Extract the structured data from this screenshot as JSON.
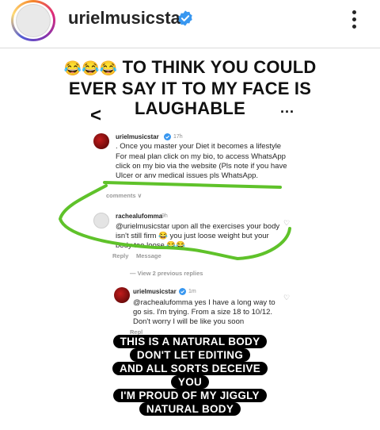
{
  "post": {
    "username": "urielmusicstar",
    "verified": true
  },
  "icons": {
    "avatar": "avatar-icon",
    "verified": "verified-badge-icon",
    "more": "more-options-icon",
    "back": "back-chevron-icon",
    "heart": "heart-icon"
  },
  "repost": {
    "caption_emojis": "😂😂😂",
    "caption_line1": "TO THINK YOU COULD",
    "caption_line2": "EVER SAY IT TO MY FACE IS",
    "caption_line3": "LAUGHABLE",
    "back_glyph": "<",
    "more_glyph": "...",
    "comment1": {
      "username": "urielmusicstar",
      "time": "17h",
      "lines": [
        ". Once you master your Diet it becomes a lifestyle",
        "For meal plan click on my bio, to access WhatsApp",
        "click on my bio via the website (Pls note if you have",
        "Ulcer or anv medical issues pls WhatsApp."
      ]
    },
    "comments_label": "comments",
    "comment2": {
      "username": "rachealufomma",
      "time": "9h",
      "lines": [
        "@urielmusicstar upon all the exercises your body",
        "isn't still firm 😂 you just loose weight but your",
        "body too loose 😂😂"
      ],
      "reply_label": "Reply",
      "message_label": "Message"
    },
    "view_replies": "View 2 previous replies",
    "comment3": {
      "username": "urielmusicstar",
      "time": "1m",
      "lines": [
        "@rachealufomma yes I have a long way to",
        "go sis. I'm trying. From a size 18 to 10/12.",
        "Don't worry I will be like you soon"
      ],
      "reply_label": "Repl"
    },
    "overlay_lines": [
      "THIS IS A NATURAL BODY",
      "DON'T LET EDITING",
      "AND ALL SORTS DECEIVE",
      "YOU",
      "I'M PROUD OF MY JIGGLY",
      "NATURAL BODY"
    ]
  },
  "colors": {
    "verified_blue": "#3897f0",
    "highlight_green": "#5fc22a",
    "overlay_bg": "#000000"
  }
}
